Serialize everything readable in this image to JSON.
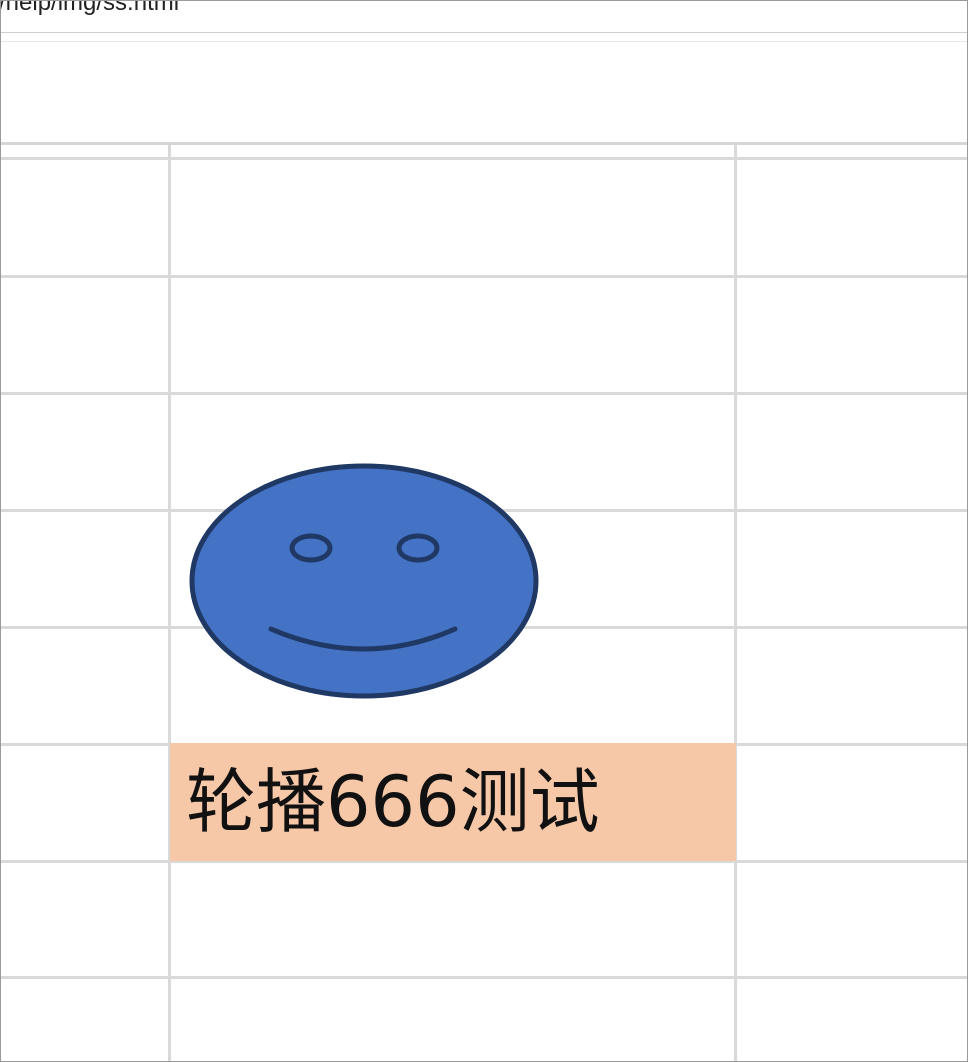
{
  "address_bar": {
    "url_fragment": "/help/img/ss.html"
  },
  "sheet": {
    "highlighted_cell": {
      "text": "轮播666测试",
      "fill_color": "#f7c8a8"
    },
    "gridline_color": "#d9d9d9"
  },
  "shape": {
    "icon": "smiley-face-icon",
    "fill_color": "#4472c4",
    "stroke_color": "#1f3864"
  }
}
